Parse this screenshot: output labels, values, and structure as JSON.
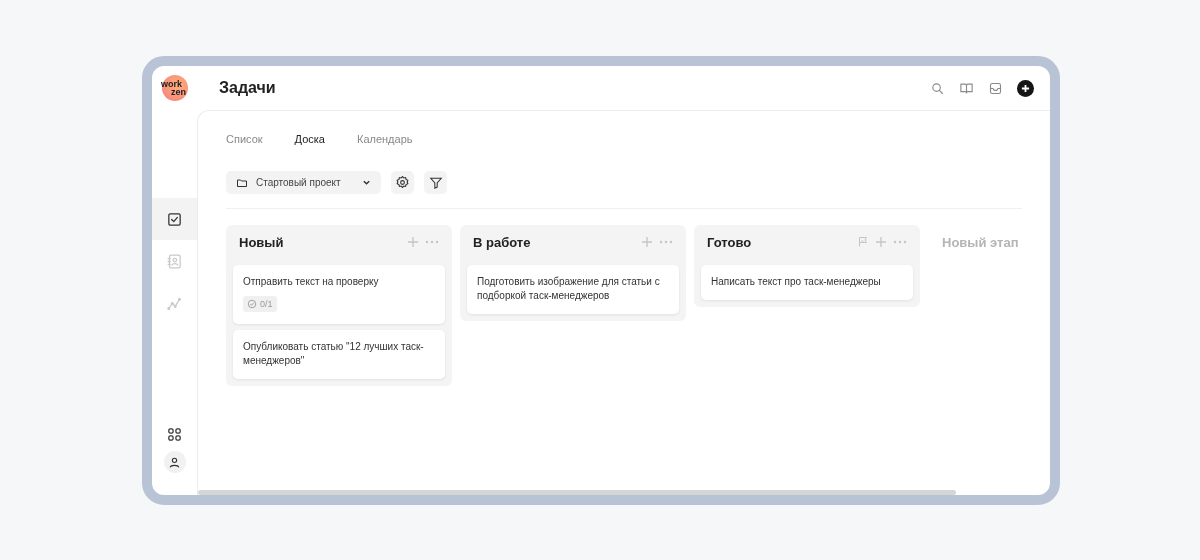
{
  "logo": {
    "line_1": "work",
    "line_2": "zen"
  },
  "header": {
    "title": "Задачи"
  },
  "sidebar": {
    "items": [
      {
        "kind": "tasks",
        "selected": true
      },
      {
        "kind": "contacts",
        "selected": false
      },
      {
        "kind": "analytics",
        "selected": false
      }
    ]
  },
  "tabs": [
    {
      "label": "Список",
      "selected": false
    },
    {
      "label": "Доска",
      "selected": true
    },
    {
      "label": "Календарь",
      "selected": false
    }
  ],
  "project_select": {
    "value": "Стартовый проект"
  },
  "columns": [
    {
      "title": "Новый",
      "flag": false,
      "cards": [
        {
          "title": "Отправить текст на проверку",
          "checklist": "0/1"
        },
        {
          "title": "Опубликовать статью \"12 лучших таск-менеджеров\""
        }
      ]
    },
    {
      "title": "В работе",
      "flag": false,
      "cards": [
        {
          "title": "Подготовить изображение для статьи с подборкой таск-менеджеров"
        }
      ]
    },
    {
      "title": "Готово",
      "flag": true,
      "cards": [
        {
          "title": "Написать текст про таск-менеджеры"
        }
      ]
    }
  ],
  "new_stage": "Новый этап"
}
